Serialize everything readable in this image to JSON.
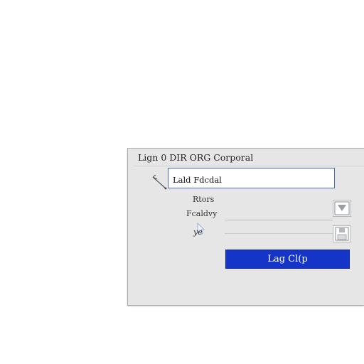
{
  "dialog": {
    "title": "Lign 0 DIR ORG Corporal",
    "input": {
      "value": "Lald Fdcdal",
      "placeholder": ""
    },
    "labels": [
      "Rtors",
      "Fcaldvy",
      "ye"
    ],
    "buttons": {
      "dropdown_icon": "chevron-down-icon",
      "save_icon": "save-icon",
      "login_label": "Lag Cl(p"
    },
    "colors": {
      "accent": "#1535c9",
      "field_border": "#4a6cae",
      "panel": "#e6e6e6"
    }
  }
}
